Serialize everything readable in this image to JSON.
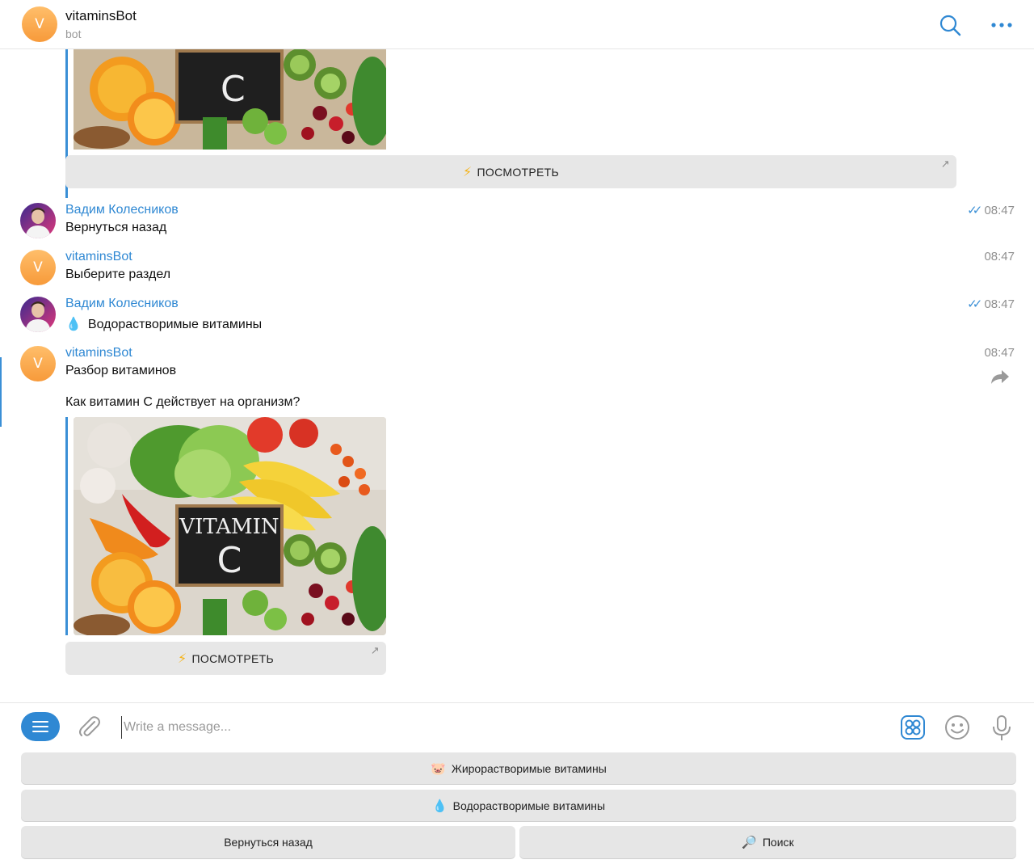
{
  "header": {
    "avatar_letter": "V",
    "title": "vitaminsBot",
    "subtitle": "bot",
    "icons": [
      "search-icon",
      "more-icon"
    ]
  },
  "chat": {
    "top_card": {
      "image": "vitamin-c-fruits-photo",
      "button_label": "ПОСМОТРЕТЬ"
    },
    "messages": [
      {
        "sender": "Вадим Колесников",
        "text": "Вернуться назад",
        "time": "08:47",
        "read": true
      },
      {
        "sender": "vitaminsBot",
        "avatar_letter": "V",
        "text": "Выберите раздел",
        "time": "08:47"
      },
      {
        "sender": "Вадим Колесников",
        "text": "Водорастворимые витамины",
        "time": "08:47",
        "read": true
      },
      {
        "sender": "vitaminsBot",
        "avatar_letter": "V",
        "text": "Разбор витаминов",
        "text2": "Как витамин С действует на организм?",
        "time": "08:47"
      }
    ],
    "bottom_card": {
      "image_caption_line1": "VITAMIN",
      "image_caption_line2": "C",
      "button_label": "ПОСМОТРЕТЬ"
    }
  },
  "compose": {
    "placeholder": "Write a message...",
    "icons": [
      "menu-icon",
      "paperclip-icon",
      "sticker-icon",
      "emoji-icon",
      "microphone-icon"
    ]
  },
  "keyboard": {
    "fat_soluble": "Жирорастворимые витамины",
    "water_soluble": "Водорастворимые витамины",
    "back": "Вернуться назад",
    "search": "Поиск"
  }
}
